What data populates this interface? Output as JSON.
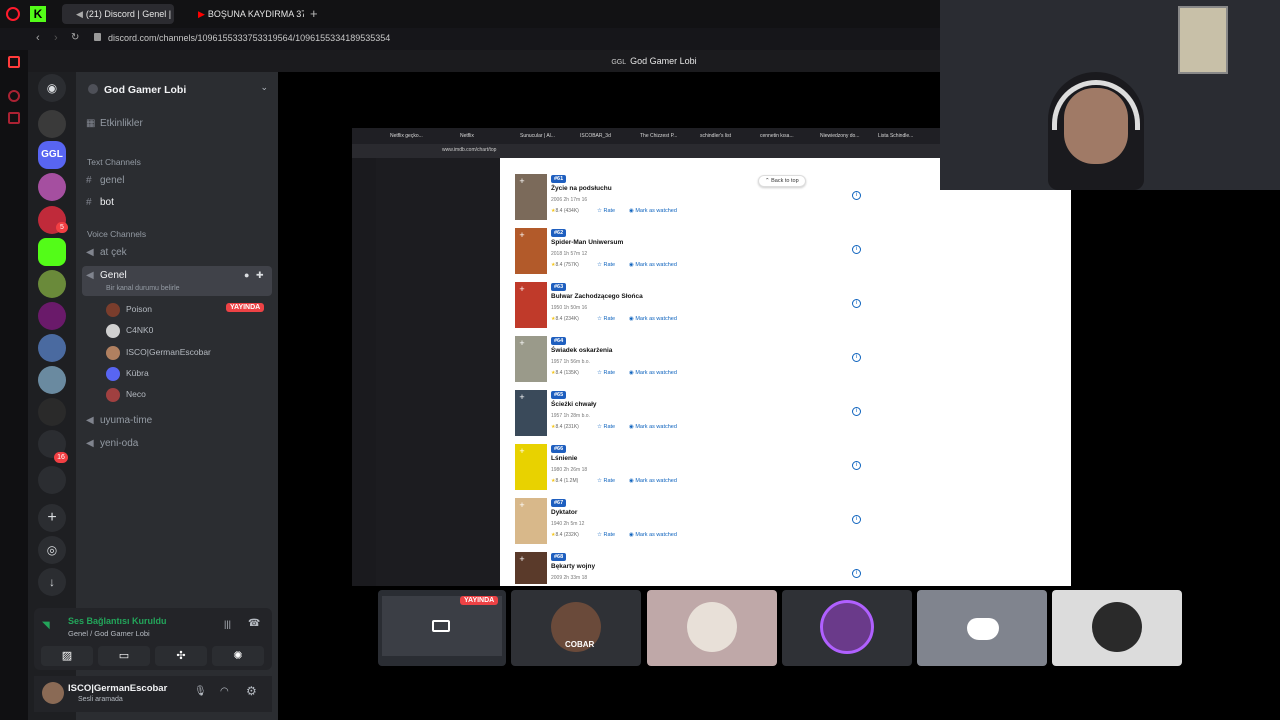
{
  "browser": {
    "tabs": [
      {
        "label": "(21) Discord | Genel | G",
        "active": true
      },
      {
        "label": "BOŞUNA KAYDIRMA 37/...",
        "active": false
      }
    ],
    "url": "discord.com/channels/1096155333753319564/1096155334189535354",
    "new_tab_icon": "plus-icon"
  },
  "discord": {
    "window_title": "God Gamer Lobi",
    "server_name": "God Gamer Lobi",
    "events_label": "Etkinlikler",
    "text_category": "Text Channels",
    "text_channels": [
      "genel",
      "bot"
    ],
    "voice_category": "Voice Channels",
    "voice_channels": {
      "at_cek": "at çek",
      "genel": "Genel",
      "genel_status": "Bir kanal durumu belirle",
      "uyuma": "uyuma-time",
      "yeni": "yeni-oda"
    },
    "voice_users": [
      {
        "name": "Poison",
        "live": true,
        "color": "#7a3d2c"
      },
      {
        "name": "C4NK0",
        "live": false,
        "color": "#d0d0d0"
      },
      {
        "name": "ISCO|GermanEscobar",
        "live": false,
        "color": "#b08060"
      },
      {
        "name": "Kübra",
        "live": false,
        "color": "#5865f2"
      },
      {
        "name": "Neco",
        "live": false,
        "color": "#a04040"
      }
    ],
    "live_label": "YAYINDA",
    "server_badges": {
      "first": "5",
      "second": "16"
    },
    "voice_panel": {
      "status": "Ses Bağlantısı Kuruldu",
      "sub": "Genel / God Gamer Lobi"
    },
    "user_panel": {
      "name": "ISCO|GermanEscobar",
      "status": "Sesli aramada"
    }
  },
  "shared_screen": {
    "tabs": [
      "Netflix geçko...",
      "Netflix",
      "Sunucular | Al...",
      "ISCOBAR_3d",
      "The Chizzest P...",
      "schindler's list",
      "cennetin kısa...",
      "Niewiedzony do...",
      "Lista Schindle..."
    ],
    "url": "www.imdb.com/chart/top",
    "back_to_top": "Back to top",
    "rate_label": "Rate",
    "watch_label": "Mark as watched",
    "movies": [
      {
        "rank": "#61",
        "title": "Życie na podsłuchu",
        "meta": "2006  2h 17m  16",
        "rating": "8.4 (434K)",
        "color": "#7b6a5a"
      },
      {
        "rank": "#62",
        "title": "Spider-Man Uniwersum",
        "meta": "2018  1h 57m  12",
        "rating": "8.4 (757K)",
        "color": "#b25a2a"
      },
      {
        "rank": "#63",
        "title": "Bulwar Zachodzącego Słońca",
        "meta": "1950  1h 50m  16",
        "rating": "8.4 (234K)",
        "color": "#c03a2a"
      },
      {
        "rank": "#64",
        "title": "Świadek oskarżenia",
        "meta": "1957  1h 56m  b.o.",
        "rating": "8.4 (135K)",
        "color": "#9a9a8a"
      },
      {
        "rank": "#65",
        "title": "Ścieżki chwały",
        "meta": "1957  1h 28m  b.o.",
        "rating": "8.4 (231K)",
        "color": "#3a4a5a"
      },
      {
        "rank": "#66",
        "title": "Lśnienie",
        "meta": "1980  2h 26m  18",
        "rating": "8.4 (1.2M)",
        "color": "#e8d200"
      },
      {
        "rank": "#67",
        "title": "Dyktator",
        "meta": "1940  2h 5m  12",
        "rating": "8.4 (232K)",
        "color": "#d8b88a"
      },
      {
        "rank": "#68",
        "title": "Bękarty wojny",
        "meta": "2009  2h 33m  18",
        "rating": "",
        "color": "#5a3a2a"
      }
    ]
  },
  "stream_tiles": [
    {
      "kind": "screen",
      "live": true,
      "color": "#2a2d33"
    },
    {
      "kind": "avatar",
      "label": "COBAR",
      "color": "#2f3136"
    },
    {
      "kind": "avatar",
      "color": "#bfa8a8"
    },
    {
      "kind": "avatar",
      "color": "#2f3136"
    },
    {
      "kind": "discord",
      "color": "#80848e"
    },
    {
      "kind": "avatar",
      "color": "#dcdcdc"
    }
  ]
}
